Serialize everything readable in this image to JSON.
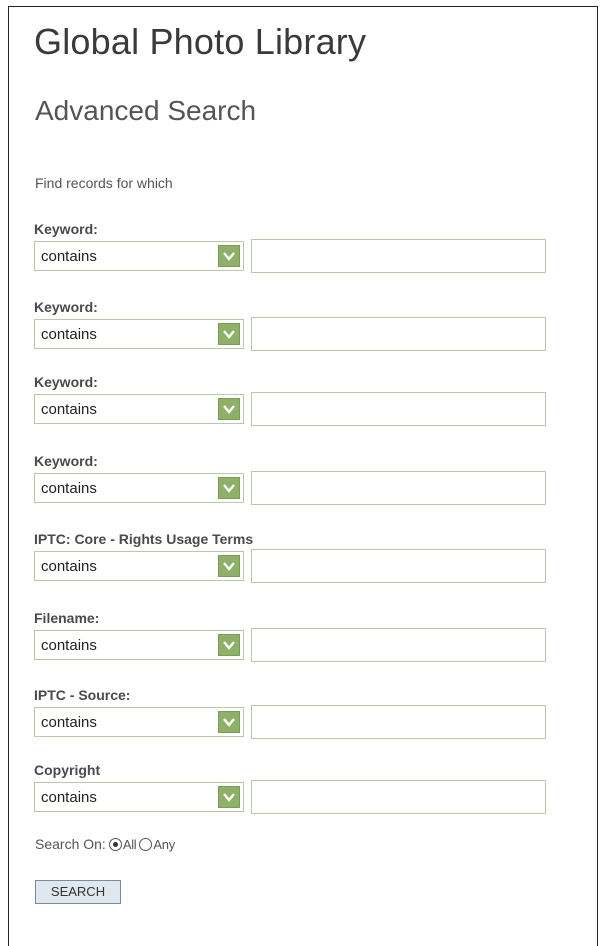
{
  "header": {
    "title": "Global Photo Library",
    "subtitle": "Advanced Search"
  },
  "form": {
    "intro": "Find records for which",
    "fields": [
      {
        "label": "Keyword:",
        "operator": "contains",
        "value": ""
      },
      {
        "label": "Keyword:",
        "operator": "contains",
        "value": ""
      },
      {
        "label": "Keyword:",
        "operator": "contains",
        "value": ""
      },
      {
        "label": "Keyword:",
        "operator": "contains",
        "value": ""
      },
      {
        "label": "IPTC: Core - Rights Usage Terms",
        "operator": "contains",
        "value": ""
      },
      {
        "label": "Filename:",
        "operator": "contains",
        "value": ""
      },
      {
        "label": "IPTC - Source:",
        "operator": "contains",
        "value": ""
      },
      {
        "label": "Copyright",
        "operator": "contains",
        "value": ""
      }
    ],
    "search_on": {
      "label": "Search On:",
      "options": [
        "All",
        "Any"
      ],
      "selected": "All"
    },
    "search_button": "SEARCH"
  },
  "colors": {
    "dropdown_arrow": "#8fb069",
    "field_border": "#b9c8a8",
    "button_background": "#dfe7ef"
  },
  "icons": {
    "dropdown": "chevron-down-icon"
  }
}
